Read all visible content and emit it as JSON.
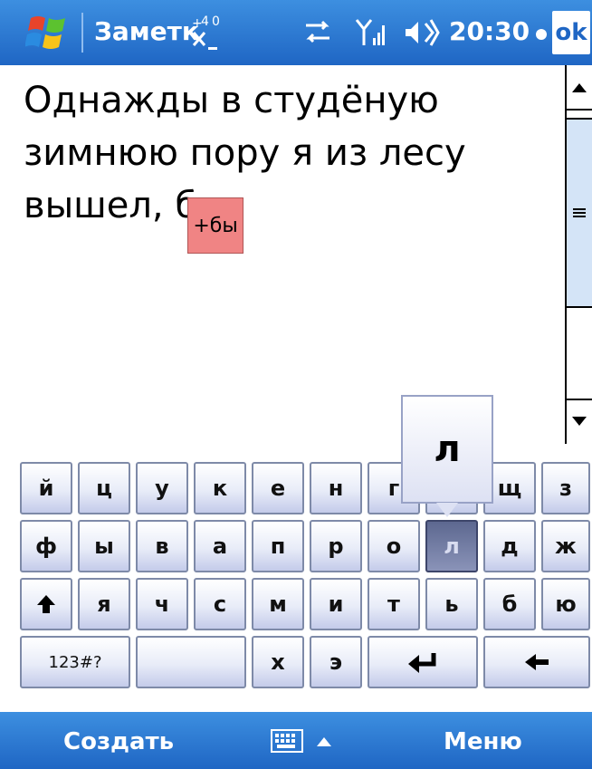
{
  "titlebar": {
    "title": "Заметк",
    "time": "20:30",
    "ok_label": "ok",
    "icons": [
      "windows-start-icon",
      "input-method-icon",
      "sync-icon",
      "signal-icon",
      "volume-icon"
    ]
  },
  "note": {
    "lines": [
      "Однажды в студёную",
      "зимнюю пору я из лесу",
      "вышел, бы"
    ],
    "suggestion": "+бы"
  },
  "keyboard": {
    "popup_char": "л",
    "rows": [
      [
        "й",
        "ц",
        "у",
        "к",
        "е",
        "н",
        "г",
        "",
        "щ",
        "з"
      ],
      [
        "ф",
        "ы",
        "в",
        "а",
        "п",
        "р",
        "о",
        "л",
        "д",
        "ж"
      ],
      [
        "я",
        "ч",
        "с",
        "м",
        "и",
        "т",
        "ь",
        "б",
        "ю"
      ],
      [
        "123#?",
        "х",
        "э"
      ]
    ],
    "pressed_key": "л"
  },
  "softbar": {
    "left_label": "Создать",
    "right_label": "Меню"
  },
  "colors": {
    "bar_blue": "#1f66c4",
    "suggestion_bg": "#f08484",
    "key_pressed": "#5d6890"
  }
}
